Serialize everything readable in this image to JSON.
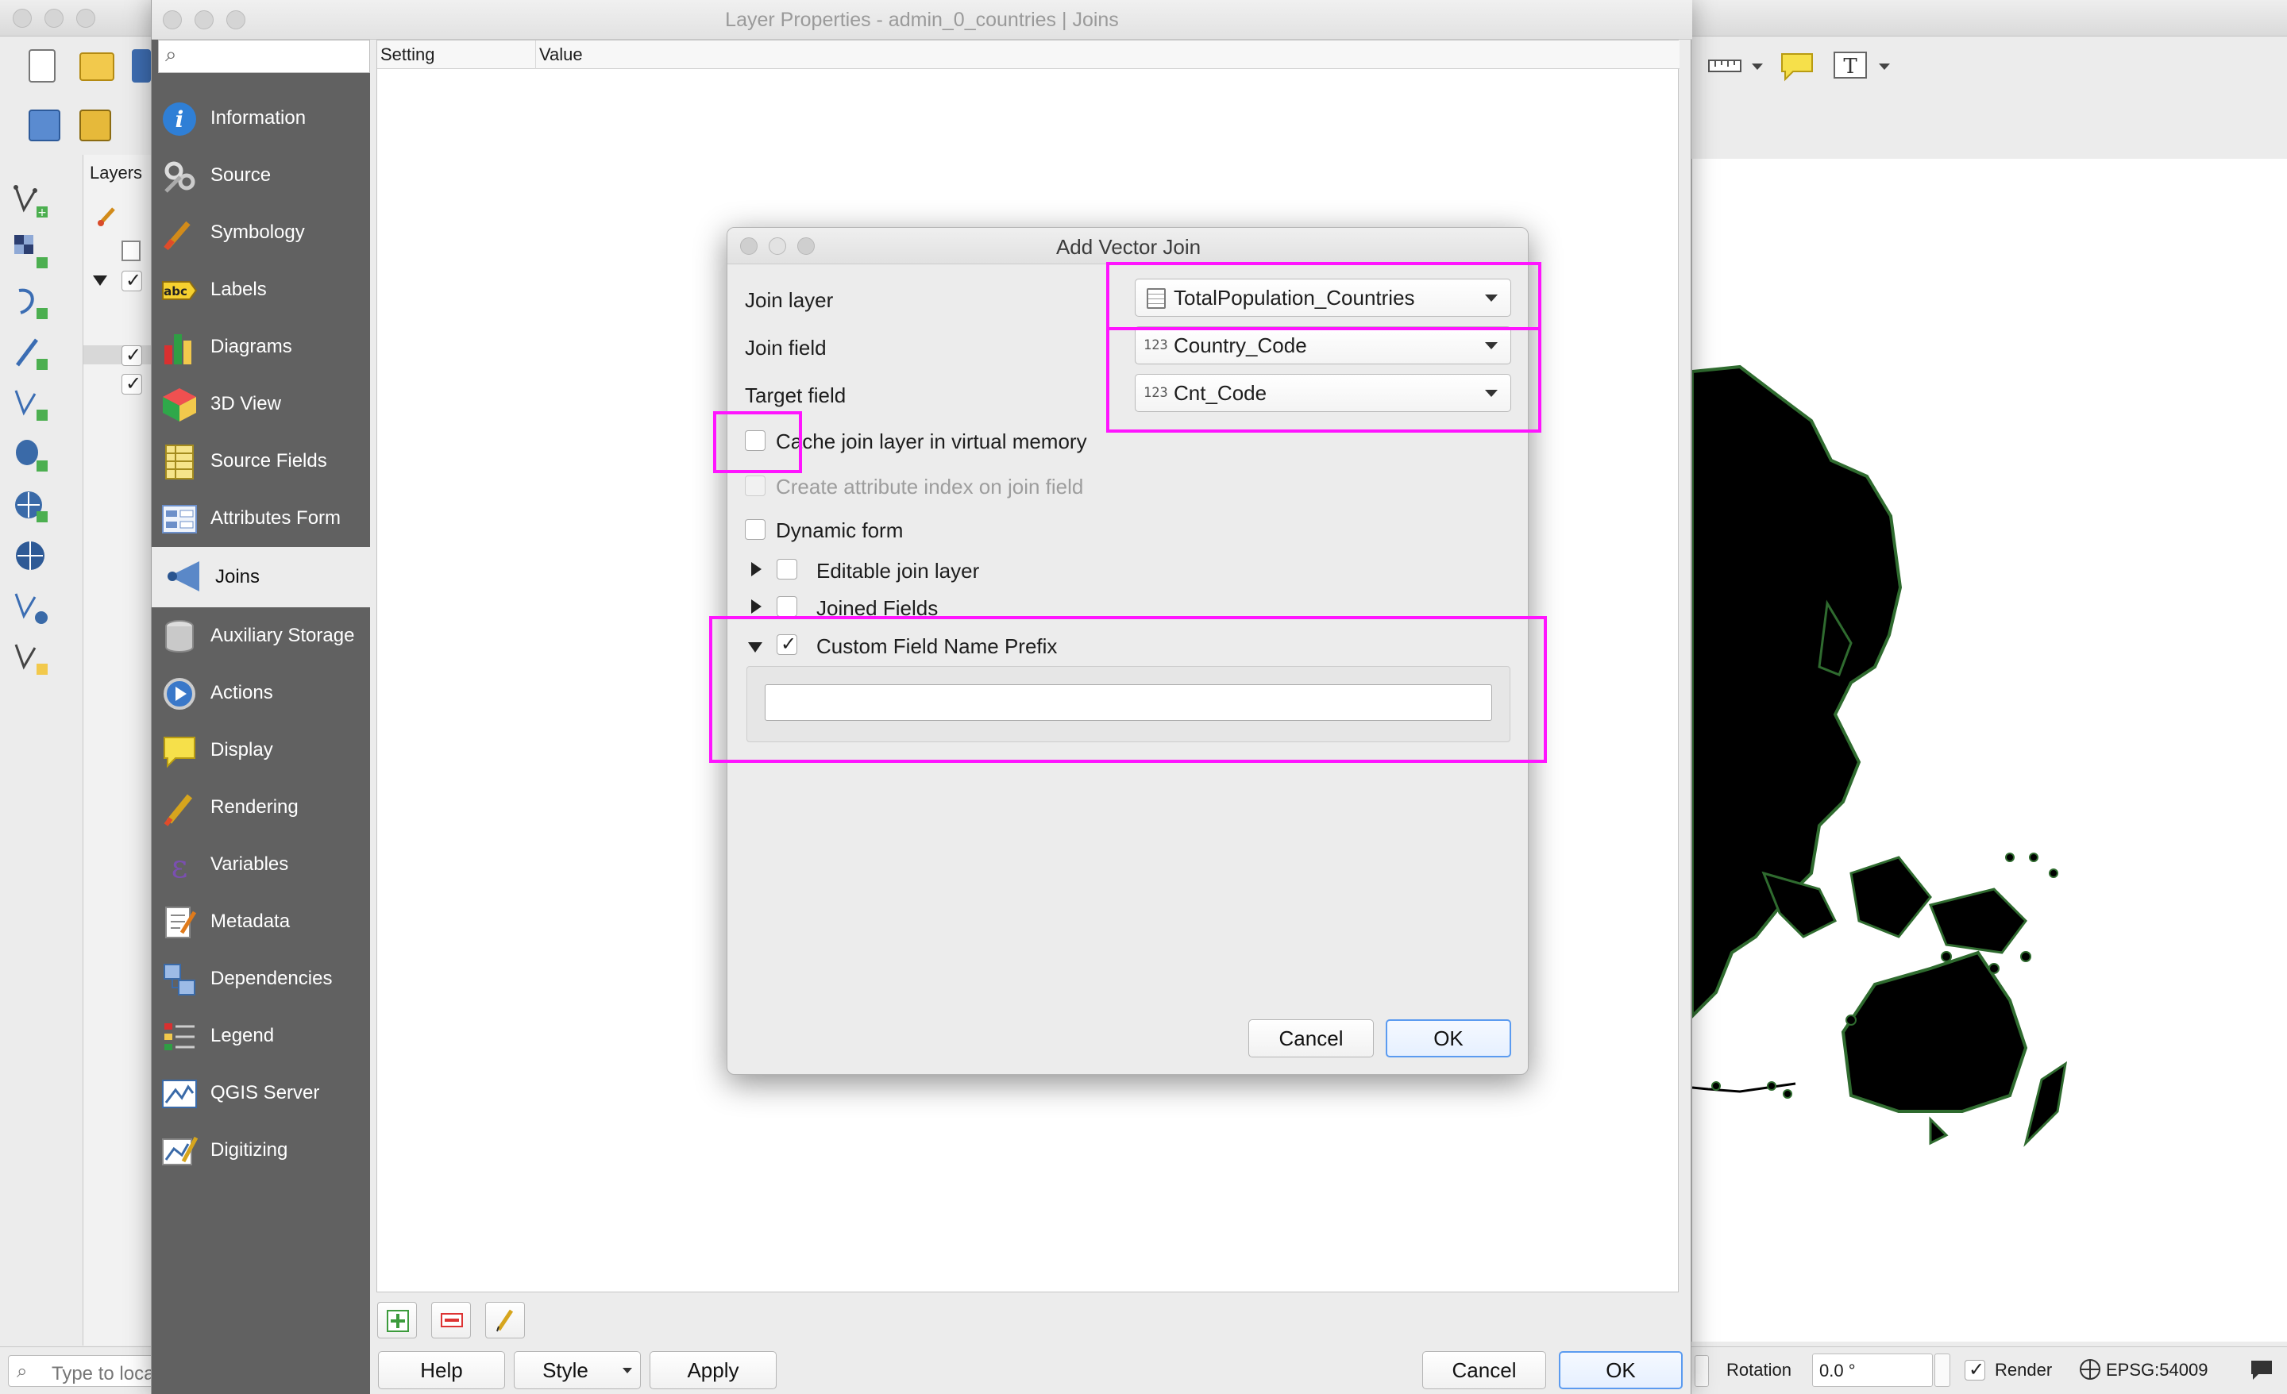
{
  "main_window": {
    "layers_panel_title": "Layers",
    "locator_placeholder": "Type to locate (⌘K)",
    "status": {
      "rotation_label": "Rotation",
      "rotation_value": "0.0 °",
      "render_label": "Render",
      "crs": "EPSG:54009"
    }
  },
  "layer_properties": {
    "title": "Layer Properties - admin_0_countries | Joins",
    "search_placeholder": "",
    "table_headers": [
      "Setting",
      "Value"
    ],
    "nav_items": [
      {
        "label": "Information",
        "icon": "info-icon"
      },
      {
        "label": "Source",
        "icon": "source-icon"
      },
      {
        "label": "Symbology",
        "icon": "symbology-icon"
      },
      {
        "label": "Labels",
        "icon": "labels-icon"
      },
      {
        "label": "Diagrams",
        "icon": "diagrams-icon"
      },
      {
        "label": "3D View",
        "icon": "cube-icon"
      },
      {
        "label": "Source Fields",
        "icon": "fields-icon"
      },
      {
        "label": "Attributes Form",
        "icon": "form-icon"
      },
      {
        "label": "Joins",
        "icon": "joins-icon",
        "active": true
      },
      {
        "label": "Auxiliary Storage",
        "icon": "database-icon"
      },
      {
        "label": "Actions",
        "icon": "actions-icon"
      },
      {
        "label": "Display",
        "icon": "display-icon"
      },
      {
        "label": "Rendering",
        "icon": "rendering-icon"
      },
      {
        "label": "Variables",
        "icon": "variables-icon"
      },
      {
        "label": "Metadata",
        "icon": "metadata-icon"
      },
      {
        "label": "Dependencies",
        "icon": "dependencies-icon"
      },
      {
        "label": "Legend",
        "icon": "legend-icon"
      },
      {
        "label": "QGIS Server",
        "icon": "server-icon"
      },
      {
        "label": "Digitizing",
        "icon": "digitizing-icon"
      }
    ],
    "buttons": {
      "help": "Help",
      "style": "Style",
      "apply": "Apply",
      "cancel": "Cancel",
      "ok": "OK"
    }
  },
  "add_vector_join": {
    "title": "Add Vector Join",
    "join_layer_label": "Join layer",
    "join_layer_value": "TotalPopulation_Countries",
    "join_field_label": "Join field",
    "join_field_value": "Country_Code",
    "target_field_label": "Target field",
    "target_field_value": "Cnt_Code",
    "field_type_badge": "123",
    "cache_label": "Cache join layer in virtual memory",
    "cache_checked": false,
    "index_label": "Create attribute index on join field",
    "index_checked": false,
    "dynamic_form_label": "Dynamic form",
    "dynamic_form_checked": false,
    "editable_label": "Editable join layer",
    "editable_checked": false,
    "joined_fields_label": "Joined Fields",
    "joined_fields_checked": false,
    "prefix_label": "Custom Field Name Prefix",
    "prefix_checked": true,
    "prefix_value": "",
    "cancel": "Cancel",
    "ok": "OK"
  },
  "colors": {
    "highlight": "#ff14ff",
    "sidebar": "#616161",
    "primary_border": "#5b9bf0"
  }
}
